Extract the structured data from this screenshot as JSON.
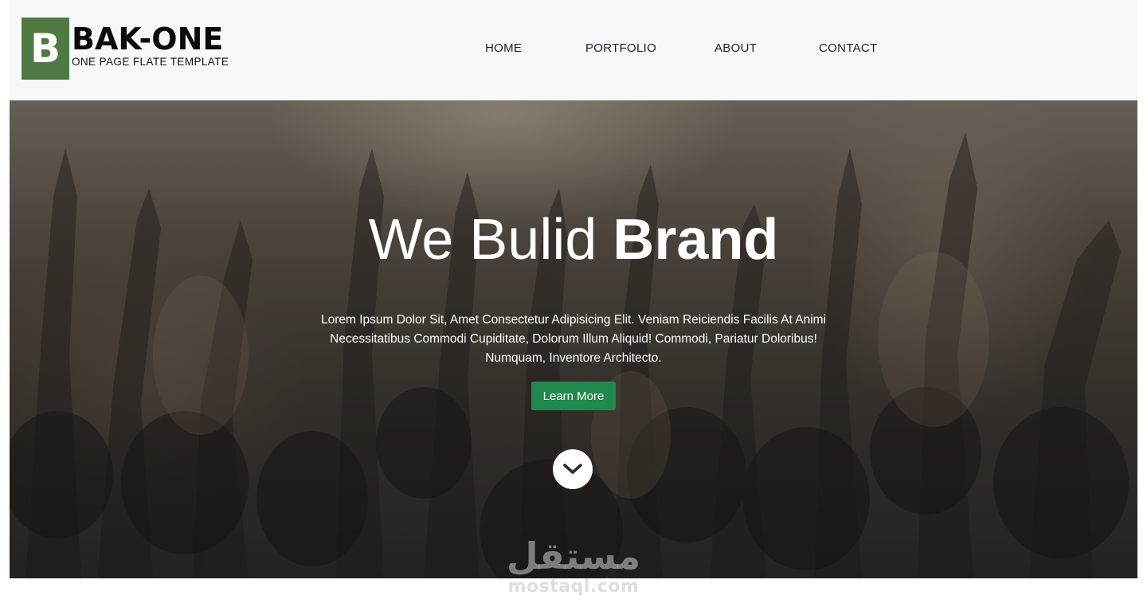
{
  "brand": {
    "mark_letter": "B",
    "name": "BAK-ONE",
    "tagline": "ONE PAGE FLATE TEMPLATE",
    "color": "#4f7a43"
  },
  "nav": {
    "items": [
      {
        "label": "HOME"
      },
      {
        "label": "PORTFOLIO"
      },
      {
        "label": "ABOUT"
      },
      {
        "label": "CONTACT"
      }
    ]
  },
  "hero": {
    "title_light": "We Bulid ",
    "title_bold": "Brand",
    "text": "Lorem Ipsum Dolor Sit, Amet Consectetur Adipisicing Elit. Veniam Reiciendis Facilis At Animi Necessitatibus Commodi Cupiditate, Dolorum Illum Aliquid! Commodi, Pariatur Doloribus! Numquam, Inventore Architecto.",
    "button_label": "Learn More",
    "button_color": "#1f8a4c",
    "scroll_icon": "chevron-down-icon"
  },
  "watermark": {
    "arabic": "مستقل",
    "latin": "mostaql.com"
  }
}
